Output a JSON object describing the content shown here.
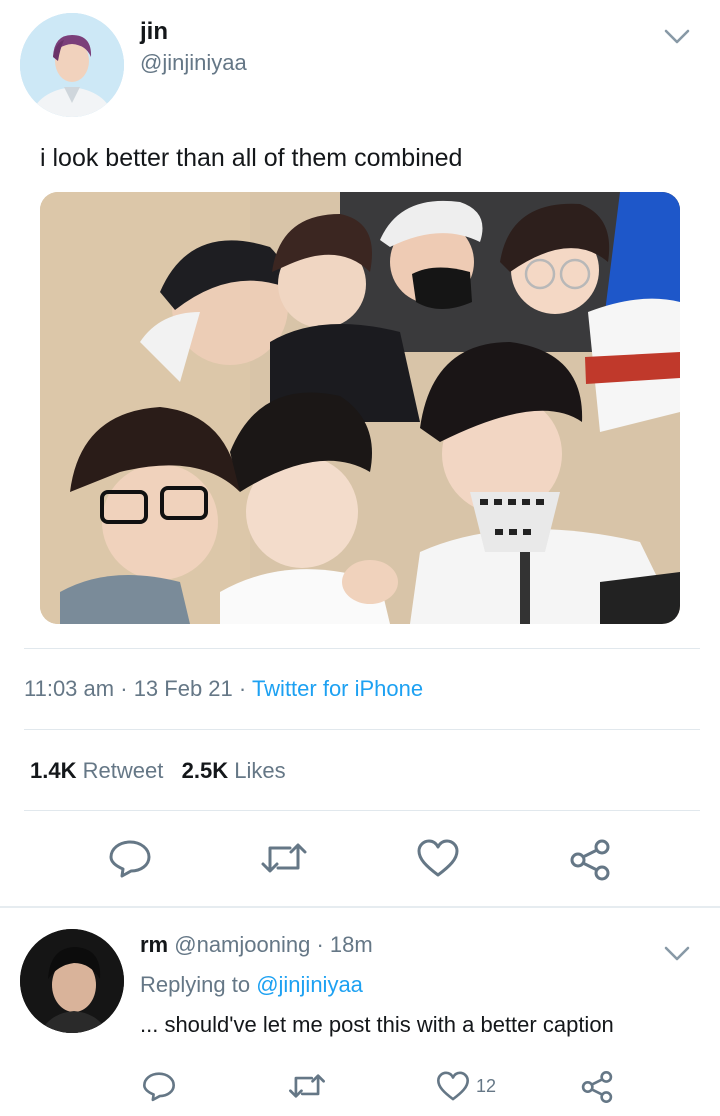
{
  "tweet": {
    "author_name": "jin",
    "author_handle": "@jinjiniyaa",
    "text": "i look better than all of them combined",
    "time": "11:03 am",
    "date": "13 Feb 21",
    "source": "Twitter for iPhone",
    "retweet_count": "1.4K",
    "retweet_label": "Retweet",
    "like_count": "2.5K",
    "like_label": "Likes",
    "sep": "·"
  },
  "reply": {
    "author_name": "rm",
    "author_handle": "@namjooning",
    "age": "18m",
    "replying_label": "Replying to",
    "replying_handle": "@jinjiniyaa",
    "text": "... should've let me post this with a better caption",
    "like_count": "12"
  },
  "colors": {
    "accent": "#1da1f2",
    "secondary_text": "#657786",
    "primary_text": "#14171a",
    "divider": "#e1e8ed"
  },
  "icons": {
    "reply": "reply-icon",
    "retweet": "retweet-icon",
    "like": "heart-icon",
    "share": "share-icon",
    "menu": "chevron-down-icon"
  }
}
